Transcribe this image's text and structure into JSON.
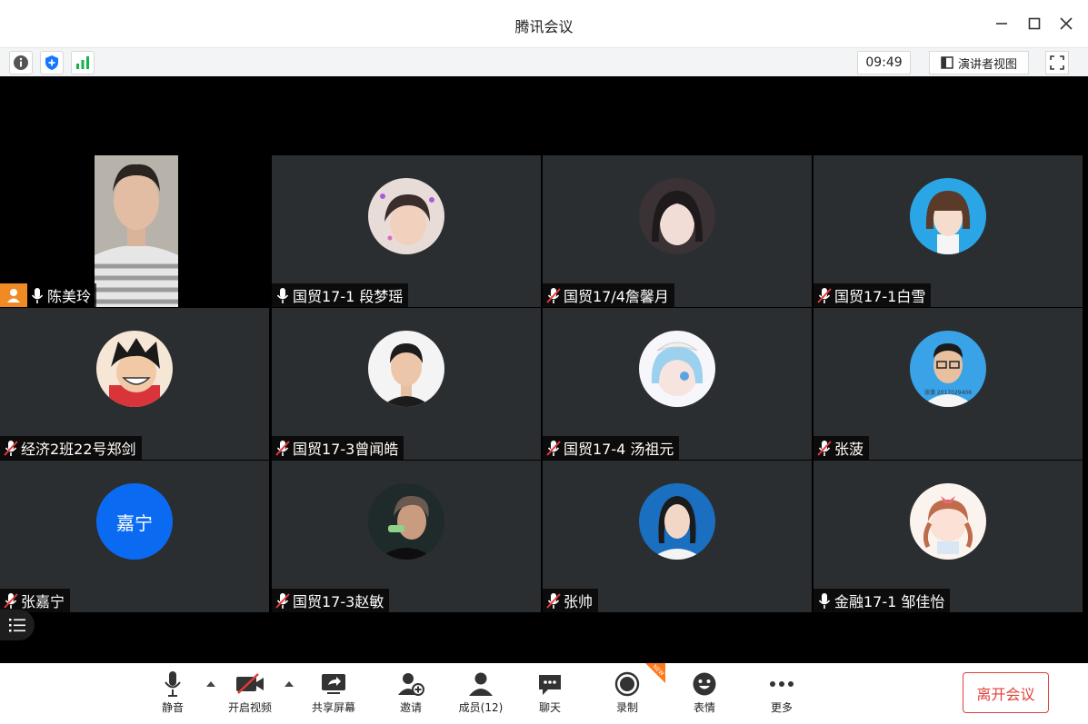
{
  "window": {
    "title": "腾讯会议"
  },
  "infobar": {
    "time": "09:49",
    "speaker_view_label": "演讲者视图"
  },
  "participants": [
    {
      "name": "陈美玲",
      "mic": "on",
      "host": true,
      "self_video": true
    },
    {
      "name": "国贸17-1 段梦瑶",
      "mic": "on",
      "avatar_color": "#e9d7d4"
    },
    {
      "name": "国贸17/4詹馨月",
      "mic": "muted",
      "avatar_color": "#3a3234"
    },
    {
      "name": "国贸17-1白雪",
      "mic": "muted",
      "avatar_color": "#2aa6e6"
    },
    {
      "name": "经济2班22号郑剑",
      "mic": "muted",
      "avatar_color": "#f3d9c3"
    },
    {
      "name": "国贸17-3曾闻皓",
      "mic": "muted",
      "avatar_color": "#f2f2f2"
    },
    {
      "name": " 国贸17-4 汤祖元",
      "mic": "muted",
      "avatar_color": "#cfe6f4"
    },
    {
      "name": "张菠",
      "mic": "muted",
      "avatar_color": "#3aa3e8",
      "avatar_caption": "张菠  2017029406"
    },
    {
      "name": "张嘉宁",
      "mic": "muted",
      "avatar_text": "嘉宁",
      "avatar_color": "#0a6bf2"
    },
    {
      "name": "国贸17-3赵敏",
      "mic": "muted",
      "avatar_color": "#1f2a2a"
    },
    {
      "name": "张帅",
      "mic": "muted",
      "avatar_color": "#1a6fc0"
    },
    {
      "name": "金融17-1 邹佳怡",
      "mic": "on",
      "avatar_color": "#fbeee9"
    }
  ],
  "toolbar": {
    "mute_label": "静音",
    "video_label": "开启视频",
    "share_label": "共享屏幕",
    "invite_label": "邀请",
    "members_label": "成员(12)",
    "chat_label": "聊天",
    "record_label": "录制",
    "record_badge": "NEW",
    "emoji_label": "表情",
    "more_label": "更多",
    "leave_label": "离开会议"
  }
}
